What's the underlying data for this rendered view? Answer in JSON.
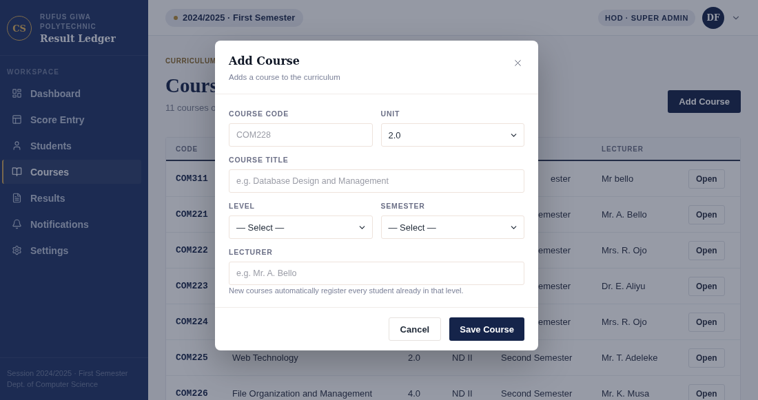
{
  "sidebar": {
    "logo_initials": "CS",
    "institution": "RUFUS GIWA POLYTECHNIC",
    "app_name": "Result Ledger",
    "section": "WORKSPACE",
    "items": [
      {
        "label": "Dashboard",
        "selected": false
      },
      {
        "label": "Score Entry",
        "selected": false
      },
      {
        "label": "Students",
        "selected": false
      },
      {
        "label": "Courses",
        "selected": true
      },
      {
        "label": "Results",
        "selected": false
      },
      {
        "label": "Notifications",
        "selected": false
      },
      {
        "label": "Settings",
        "selected": false
      }
    ],
    "footer": [
      "Session 2024/2025 · First Semester",
      "Dept. of Computer Science"
    ]
  },
  "topbar": {
    "session": "2024/2025 ·  First Semester",
    "role": "HOD · SUPER ADMIN",
    "avatar_initials": "DF"
  },
  "page": {
    "eyebrow": "CURRICULUM",
    "title": "Cours",
    "subtitle": "11 courses o",
    "add_button": "Add Course"
  },
  "table": {
    "header": {
      "code": "CODE",
      "lecturer": "LECTURER"
    },
    "rows": [
      {
        "code": "COM311",
        "semester": "ester",
        "lecturer": "Mr bello",
        "action": "Open"
      },
      {
        "code": "COM221",
        "semester": "emester",
        "lecturer": "Mr. A. Bello",
        "action": "Open"
      },
      {
        "code": "COM222",
        "semester": "emester",
        "lecturer": "Mrs. R. Ojo",
        "action": "Open"
      },
      {
        "code": "COM223",
        "semester": "emester",
        "lecturer": "Dr. E. Aliyu",
        "action": "Open"
      },
      {
        "code": "COM224",
        "semester": "emester",
        "lecturer": "Mrs. R. Ojo",
        "action": "Open"
      },
      {
        "code": "COM225",
        "title": "Web Technology",
        "units": "2.0",
        "level": "ND II",
        "semester": "Second Semester",
        "lecturer": "Mr. T. Adeleke",
        "action": "Open"
      },
      {
        "code": "COM226",
        "title": "File Organization and Management",
        "units": "4.0",
        "level": "ND II",
        "semester": "Second Semester",
        "lecturer": "Mr. K. Musa",
        "action": "Open"
      }
    ]
  },
  "modal": {
    "title": "Add Course",
    "subtitle": "Adds a course to the curriculum",
    "rows": [
      {
        "fields": [
          {
            "kind": "input",
            "label": "COURSE CODE",
            "placeholder": "COM228"
          },
          {
            "kind": "select",
            "label": "UNIT",
            "value": "2.0"
          }
        ]
      },
      {
        "fields": [
          {
            "kind": "input",
            "label": "COURSE TITLE",
            "placeholder": "e.g. Database Design and Management"
          }
        ]
      },
      {
        "fields": [
          {
            "kind": "select",
            "label": "LEVEL",
            "value": "— Select —"
          },
          {
            "kind": "select",
            "label": "SEMESTER",
            "value": "— Select —"
          }
        ]
      },
      {
        "fields": [
          {
            "kind": "input",
            "label": "LECTURER",
            "placeholder": "e.g. Mr. A. Bello"
          }
        ]
      }
    ],
    "hint": "New courses automatically register every student already in that level.",
    "cancel": "Cancel",
    "save": "Save Course"
  }
}
